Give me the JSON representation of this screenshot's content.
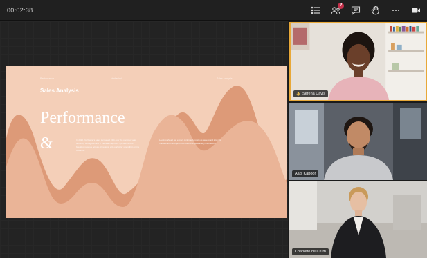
{
  "meeting": {
    "timer": "00:02:38"
  },
  "toolbar": {
    "icons": [
      "list-icon",
      "participants-icon",
      "chat-icon",
      "raise-hand-icon",
      "more-icon",
      "camera-icon"
    ],
    "participants_badge": "2"
  },
  "slide": {
    "top_left": "Performance",
    "top_mid": "Northwind",
    "top_right": "Sales Analysis",
    "subtitle": "Sales Analysis",
    "title": "Performance",
    "title2": "&",
    "body1": "In 2022, Northwind's sales increased 24% over the previous year, driven by strong demand in the retail segment. Q3 saw record-breaking revenue across all regions, with particular strength in online channels.",
    "body2": "Looking ahead, we expect continued growth as we expand into new markets and strengthen our partnerships with key distributors."
  },
  "participants": [
    {
      "name": "Serena Davis",
      "raised_hand": true,
      "active": true
    },
    {
      "name": "Aadi Kapoor",
      "raised_hand": false,
      "active": false
    },
    {
      "name": "Charlotte de Crum",
      "raised_hand": false,
      "active": false
    }
  ],
  "colors": {
    "accent_active": "#e8a838",
    "slide_bg": "#f4cfb8",
    "wave_dark": "#dd9a78",
    "wave_light": "#eab497",
    "badge": "#c4314b"
  }
}
